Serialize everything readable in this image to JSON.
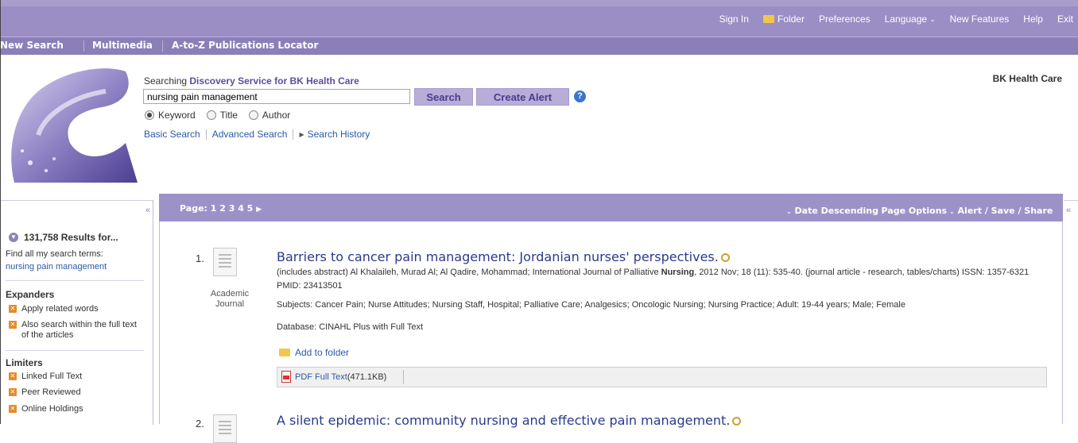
{
  "topbar": {
    "links": [
      "Sign In",
      "Folder",
      "Preferences",
      "Language",
      "New Features",
      "Help",
      "Exit"
    ]
  },
  "nav": {
    "new_search": "New Search",
    "multimedia": "Multimedia",
    "publications": "A-to-Z Publications Locator"
  },
  "search": {
    "searching_prefix": "Searching",
    "database": "Discovery Service for BK Health Care",
    "query": "nursing pain management",
    "search_button": "Search",
    "alert_button": "Create Alert",
    "help_glyph": "?",
    "fields": [
      "Keyword",
      "Title",
      "Author"
    ],
    "selected_field": "Keyword",
    "links": {
      "basic": "Basic Search",
      "advanced": "Advanced Search",
      "history": "Search History"
    },
    "organization": "BK Health Care"
  },
  "left": {
    "collapse_glyph": "«",
    "results_label": "131,758 Results for...",
    "find_all": "Find all my search terms:",
    "terms_link": "nursing pain management",
    "expanders_title": "Expanders",
    "expanders": [
      "Apply related words",
      "Also search within the full text of the articles"
    ],
    "limiters_title": "Limiters",
    "limiters": [
      "Linked Full Text",
      "Peer Reviewed",
      "Online Holdings"
    ]
  },
  "results_bar": {
    "page_label": "Page: 1 2 3 4 5",
    "sort": "Date Descending",
    "page_options": "Page Options",
    "alert_share": "Alert / Save / Share",
    "collapse_glyph": "«"
  },
  "results": [
    {
      "number": "1.",
      "type": "Academic Journal",
      "title": "Barriers to cancer pain management: Jordanian nurses' perspectives.",
      "meta_before_bold": "(includes abstract) Al Khalaileh, Murad Al; Al Qadire, Mohammad; International Journal of Palliative ",
      "meta_bold": "Nursing",
      "meta_after_bold": ", 2012 Nov; 18 (11): 535-40. (journal article - research, tables/charts) ISSN: 1357-6321 PMID: 23413501",
      "subjects": "Subjects: Cancer Pain; Nurse Attitudes; Nursing Staff, Hospital; Palliative Care; Analgesics; Oncologic Nursing; Nursing Practice; Adult: 19-44 years; Male; Female",
      "database": "Database: CINAHL Plus with Full Text",
      "add_folder": "Add to folder",
      "pdf_link": "PDF Full Text",
      "pdf_size": "(471.1KB)"
    },
    {
      "number": "2.",
      "title": "A silent epidemic: community nursing and effective pain management."
    }
  ],
  "colors": {
    "topbar": "#9b8ec4",
    "accent": "#5f4c9e",
    "link": "#2a5aa8",
    "button": "#b7add8"
  }
}
